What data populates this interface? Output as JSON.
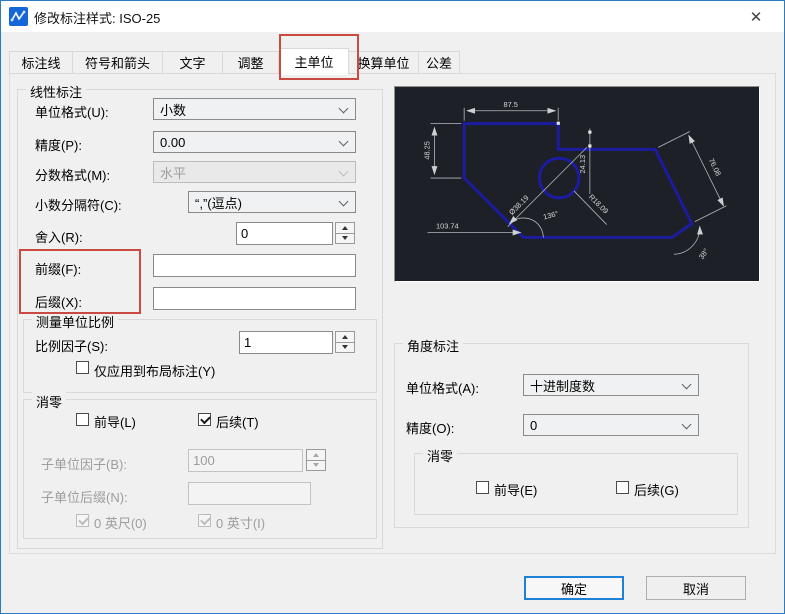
{
  "window": {
    "title": "修改标注样式: ISO-25",
    "close_glyph": "✕"
  },
  "tabs": {
    "items": [
      {
        "label": "标注线"
      },
      {
        "label": "符号和箭头"
      },
      {
        "label": "文字"
      },
      {
        "label": "调整"
      },
      {
        "label": "主单位",
        "active": true
      },
      {
        "label": "换算单位"
      },
      {
        "label": "公差"
      }
    ]
  },
  "linear": {
    "group_title": "线性标注",
    "unit_format_label": "单位格式(U):",
    "unit_format_value": "小数",
    "precision_label": "精度(P):",
    "precision_value": "0.00",
    "fraction_label": "分数格式(M):",
    "fraction_value": "水平",
    "separator_label": "小数分隔符(C):",
    "separator_value": "“,”(逗点)",
    "round_label": "舍入(R):",
    "round_value": "0",
    "prefix_label": "前缀(F):",
    "prefix_value": "",
    "suffix_label": "后缀(X):",
    "suffix_value": ""
  },
  "measure_scale": {
    "group_title": "测量单位比例",
    "factor_label": "比例因子(S):",
    "factor_value": "1",
    "layout_only_label": "仅应用到布局标注(Y)",
    "layout_only_checked": false
  },
  "zero_suppress": {
    "group_title": "消零",
    "leading_label": "前导(L)",
    "leading_checked": false,
    "trailing_label": "后续(T)",
    "trailing_checked": true,
    "sub_factor_label": "子单位因子(B):",
    "sub_factor_value": "100",
    "sub_suffix_label": "子单位后缀(N):",
    "sub_suffix_value": "",
    "feet_label": "0 英尺(0)",
    "feet_checked": true,
    "inch_label": "0 英寸(I)",
    "inch_checked": true
  },
  "angular": {
    "group_title": "角度标注",
    "unit_format_label": "单位格式(A):",
    "unit_format_value": "十进制度数",
    "precision_label": "精度(O):",
    "precision_value": "0",
    "zero_group_title": "消零",
    "leading_label": "前导(E)",
    "leading_checked": false,
    "trailing_label": "后续(G)",
    "trailing_checked": false
  },
  "preview": {
    "dims": {
      "top": "87.5",
      "left": "48.25",
      "mid": "24.13",
      "right": "76.08",
      "dia": "Ø38.19",
      "radius": "R18.09",
      "angle": "136°",
      "bottom": "103.74",
      "angle2": "38°"
    },
    "colors": {
      "background": "#1d2026",
      "shape": "#1c1ca0",
      "dims": "#b4b8bf"
    }
  },
  "buttons": {
    "ok": "确定",
    "cancel": "取消"
  }
}
